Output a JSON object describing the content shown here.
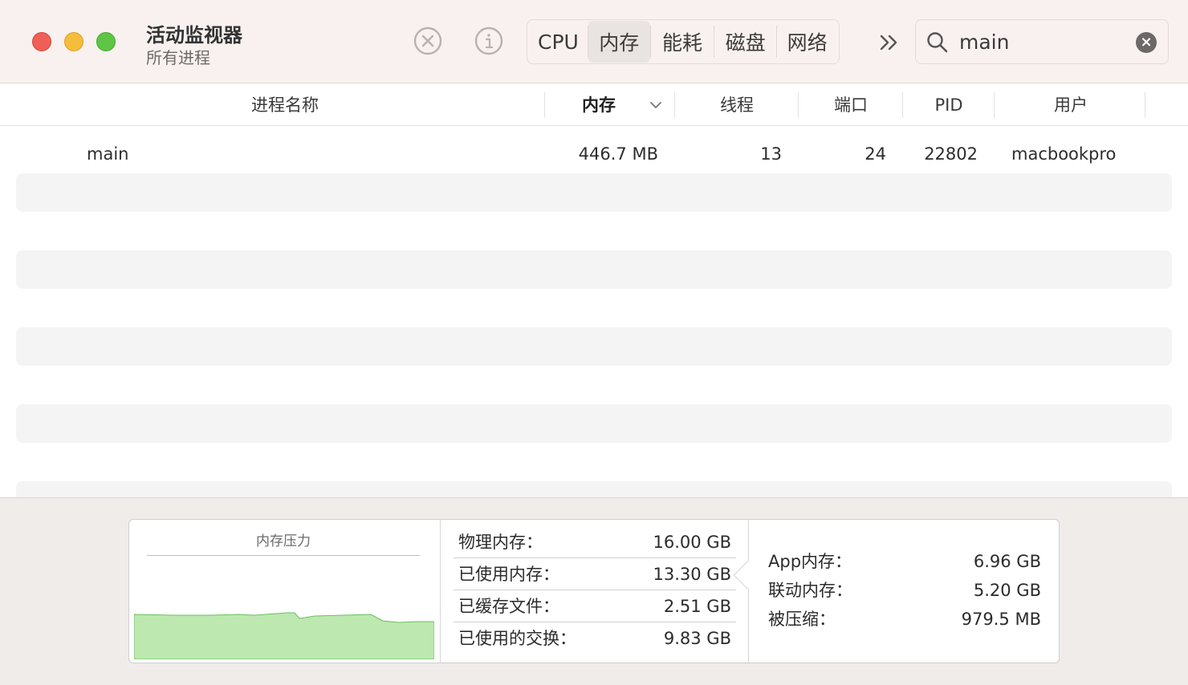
{
  "window": {
    "title": "活动监视器",
    "subtitle": "所有进程"
  },
  "toolbar": {
    "tabs": [
      {
        "label": "CPU",
        "selected": false
      },
      {
        "label": "内存",
        "selected": true
      },
      {
        "label": "能耗",
        "selected": false
      },
      {
        "label": "磁盘",
        "selected": false
      },
      {
        "label": "网络",
        "selected": false
      }
    ],
    "icons": [
      "stop-process-icon",
      "info-icon",
      "chevron-double-right-icon"
    ]
  },
  "search": {
    "value": "main",
    "icon": "search-icon",
    "clear_icon": "clear-icon"
  },
  "table": {
    "columns": {
      "name": "进程名称",
      "memory": "内存",
      "threads": "线程",
      "ports": "端口",
      "pid": "PID",
      "user": "用户"
    },
    "sorted_by": "memory",
    "sort_direction": "descending",
    "rows": [
      {
        "name": "main",
        "memory": "446.7 MB",
        "threads": "13",
        "ports": "24",
        "pid": "22802",
        "user": "macbookpro"
      }
    ]
  },
  "memory_pressure": {
    "title": "内存压力",
    "color": "#bde8b0",
    "stroke_color": "#6bbf5c"
  },
  "stats": {
    "physical_label": "物理内存：",
    "physical_value": "16.00 GB",
    "used_label": "已使用内存：",
    "used_value": "13.30 GB",
    "cached_label": "已缓存文件：",
    "cached_value": "2.51 GB",
    "swap_label": "已使用的交换：",
    "swap_value": "9.83 GB",
    "app_label": "App内存：",
    "app_value": "6.96 GB",
    "wired_label": "联动内存：",
    "wired_value": "5.20 GB",
    "compressed_label": "被压缩：",
    "compressed_value": "979.5 MB"
  }
}
